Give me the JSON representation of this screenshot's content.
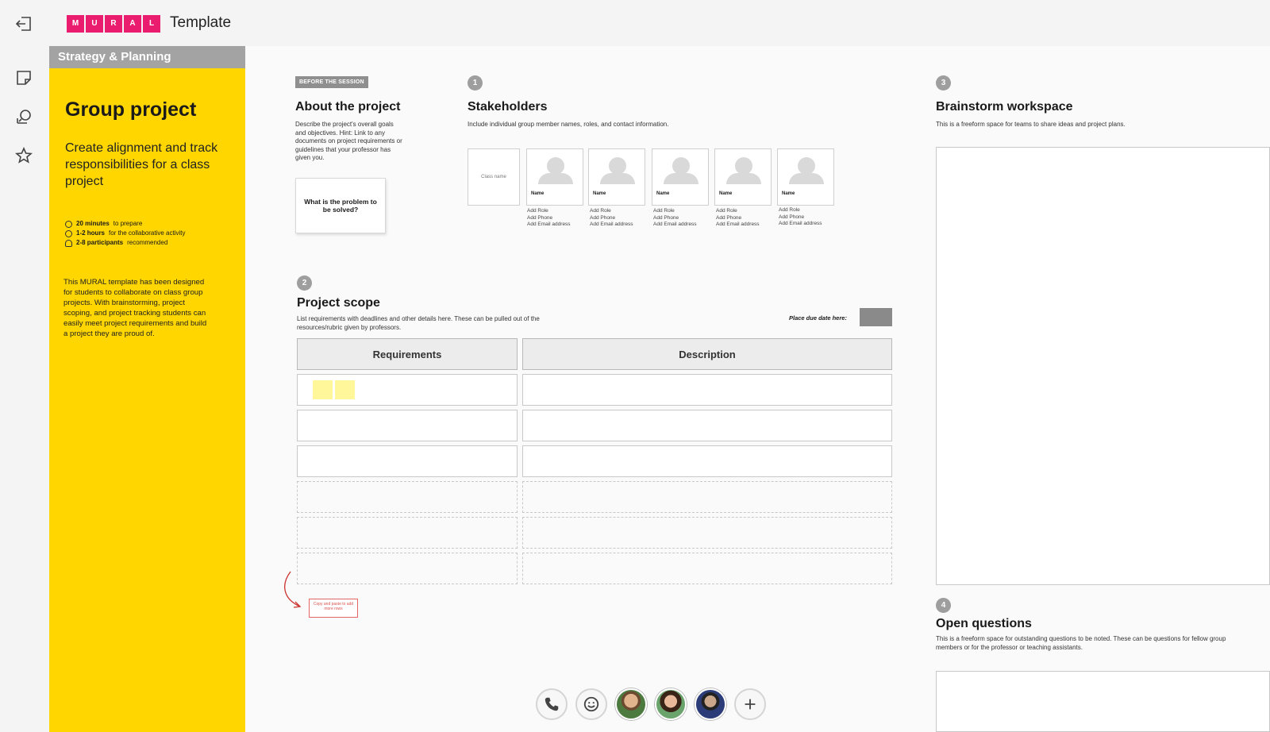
{
  "header": {
    "title": "Template",
    "logo_letters": [
      "M",
      "U",
      "R",
      "A",
      "L"
    ],
    "brand_color": "#ea1c6d"
  },
  "rail": {
    "icons": [
      "exit-icon",
      "sticky-note-icon",
      "comment-icon",
      "star-icon"
    ]
  },
  "panel": {
    "category": "Strategy & Planning",
    "title": "Group project",
    "subtitle": "Create alignment and track responsibilities for a class project",
    "meta": [
      {
        "bold": "20 minutes",
        "rest": "to prepare"
      },
      {
        "bold": "1-2 hours",
        "rest": "for the collaborative activity"
      },
      {
        "bold": "2-8 participants",
        "rest": "recommended"
      }
    ],
    "description": "This MURAL template has been designed for students to collaborate on class group projects. With brainstorming, project scoping, and project tracking students can easily meet project requirements and build a project they are proud of."
  },
  "about": {
    "badge": "BEFORE THE SESSION",
    "title": "About the project",
    "text": "Describe the project's overall goals and objectives. Hint: Link to any documents on project requirements or guidelines that your professor has given you.",
    "card": "What is the problem to be solved?"
  },
  "stakeholders": {
    "number": "1",
    "title": "Stakeholders",
    "text": "Include individual group member names, roles, and contact information.",
    "class_card": "Class name",
    "people": [
      {
        "name": "Name",
        "role": "Add Role",
        "phone": "Add Phone",
        "email": "Add Email address"
      },
      {
        "name": "Name",
        "role": "Add Role",
        "phone": "Add Phone",
        "email": "Add Email address"
      },
      {
        "name": "Name",
        "role": "Add Role",
        "phone": "Add Phone",
        "email": "Add Email address"
      },
      {
        "name": "Name",
        "role": "Add Role",
        "phone": "Add Phone",
        "email": "Add Email address"
      },
      {
        "name": "Name",
        "role": "Add Role",
        "phone": "Add Phone",
        "email": "Add Email address"
      }
    ]
  },
  "scope": {
    "number": "2",
    "title": "Project scope",
    "text": "List requirements with deadlines and other details here. These can be pulled out of the resources/rubric given by professors.",
    "due_label": "Place due date here:",
    "columns": [
      "Requirements",
      "Description"
    ],
    "hint": "Copy and paste to add more rows"
  },
  "brainstorm": {
    "number": "3",
    "title": "Brainstorm workspace",
    "text": "This is a freeform space for teams to share ideas and project plans."
  },
  "questions": {
    "number": "4",
    "title": "Open questions",
    "text": "This is a freeform space for outstanding questions to be noted. These can be questions for fellow group members or for the professor or teaching assistants."
  },
  "toolbar": {
    "items": [
      "phone-icon",
      "emoji-icon",
      "avatar-1",
      "avatar-2",
      "avatar-3",
      "add-icon"
    ]
  }
}
